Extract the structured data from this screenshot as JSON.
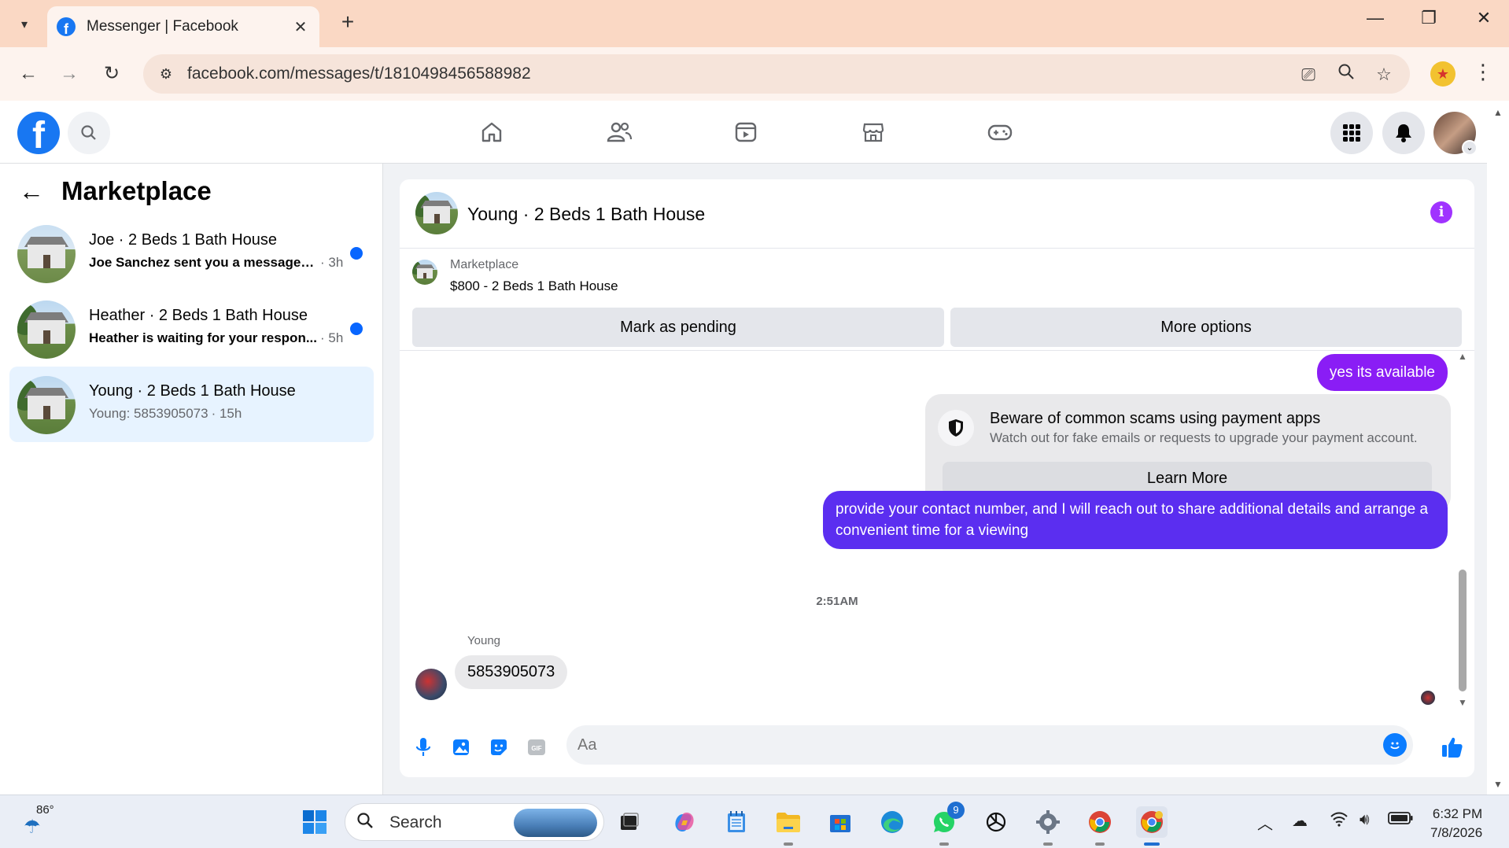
{
  "browser": {
    "tab_title": "Messenger | Facebook",
    "url": "facebook.com/messages/t/1810498456588982",
    "accent": "#fad8c4"
  },
  "sidebar": {
    "title": "Marketplace",
    "conversations": [
      {
        "name": "Joe · 2 Beds 1 Bath House",
        "preview": "Joe Sanchez sent you a message a...",
        "time": "· 3h",
        "unread": true
      },
      {
        "name": "Heather · 2 Beds 1 Bath House",
        "preview": "Heather is waiting for your respon...",
        "time": "· 5h",
        "unread": true
      },
      {
        "name": "Young · 2 Beds 1 Bath House",
        "preview": "Young: 5853905073",
        "time": "· 15h",
        "unread": false
      }
    ]
  },
  "chat": {
    "title": "Young · 2 Beds 1 Bath House",
    "listing": {
      "source": "Marketplace",
      "price_title": "$800 - 2 Beds 1 Bath House",
      "pending_label": "Mark as pending",
      "more_label": "More options"
    },
    "messages": {
      "out_1": "yes its available",
      "scam_title": "Beware of common scams using payment apps",
      "scam_desc": "Watch out for fake emails or requests to upgrade your payment account.",
      "learn_more": "Learn More",
      "out_2": "provide your contact number, and I will reach out to share additional details and arrange a convenient time for a viewing",
      "timestamp": "2:51AM",
      "sender": "Young",
      "in_1": "5853905073"
    },
    "composer": {
      "placeholder": "Aa"
    },
    "colors": {
      "outgoing_bubble": "#8a1df5",
      "accent_blue": "#0a7cff"
    }
  },
  "taskbar": {
    "weather_temp": "86°",
    "search_label": "Search",
    "whatsapp_badge": "9",
    "time": "6:32 PM",
    "date": "7/8/2026"
  }
}
